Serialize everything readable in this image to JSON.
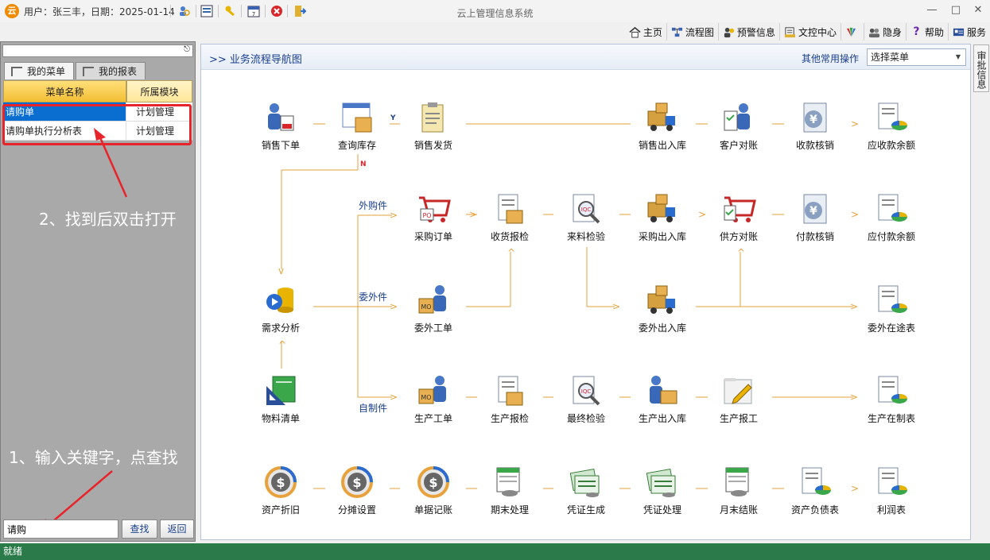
{
  "titlebar": {
    "userinfo": "用户：张三丰，日期：2025-01-14",
    "title": "云上管理信息系统",
    "icons": [
      "user-search-icon",
      "list-icon",
      "key-icon",
      "calendar-icon",
      "close-red-icon",
      "exit-icon"
    ]
  },
  "toolbar": {
    "items": [
      {
        "label": "主页",
        "icon": "home-icon"
      },
      {
        "label": "流程图",
        "icon": "flowchart-icon"
      },
      {
        "label": "预警信息",
        "icon": "alert-icon"
      },
      {
        "label": "文控中心",
        "icon": "document-icon"
      },
      {
        "label": "",
        "icon": "color-icon"
      },
      {
        "label": "隐身",
        "icon": "hide-icon"
      },
      {
        "label": "帮助",
        "icon": "help-icon"
      },
      {
        "label": "服务",
        "icon": "service-icon"
      }
    ]
  },
  "sidebar": {
    "tabs": [
      "我的菜单",
      "我的报表"
    ],
    "grid": {
      "headers": [
        "菜单名称",
        "所属模块"
      ],
      "rows": [
        [
          "请购单",
          "计划管理"
        ],
        [
          "请购单执行分析表",
          "计划管理"
        ]
      ]
    },
    "annotation_2": "2、找到后双击打开",
    "annotation_1": "1、输入关键字，点查找",
    "search": {
      "value": "请购"
    },
    "find_button": "查找",
    "back_button": "返回"
  },
  "main": {
    "title": ">>  业务流程导航图",
    "quick_label": "其他常用操作",
    "select_value": "选择菜单",
    "branch_labels": {
      "y": "Y",
      "n": "N",
      "outsource_purchase": "外购件",
      "outsource_work": "委外件",
      "self_made": "自制件"
    },
    "nodes": {
      "r1": [
        "销售下单",
        "查询库存",
        "销售发货",
        "销售出入库",
        "客户对账",
        "收款核销",
        "应收款余额"
      ],
      "r2": [
        "采购订单",
        "收货报检",
        "来料检验",
        "采购出入库",
        "供方对账",
        "付款核销",
        "应付款余额"
      ],
      "r3": [
        "需求分析",
        "委外工单",
        "委外出入库",
        "委外在途表"
      ],
      "r4": [
        "物料清单",
        "生产工单",
        "生产报检",
        "最终检验",
        "生产出入库",
        "生产报工",
        "生产在制表"
      ],
      "r5": [
        "资产折旧",
        "分摊设置",
        "单据记账",
        "期末处理",
        "凭证生成",
        "凭证处理",
        "月末结账",
        "资产负债表",
        "利润表"
      ]
    }
  },
  "right_tab": "审批信息",
  "statusbar": "就绪"
}
